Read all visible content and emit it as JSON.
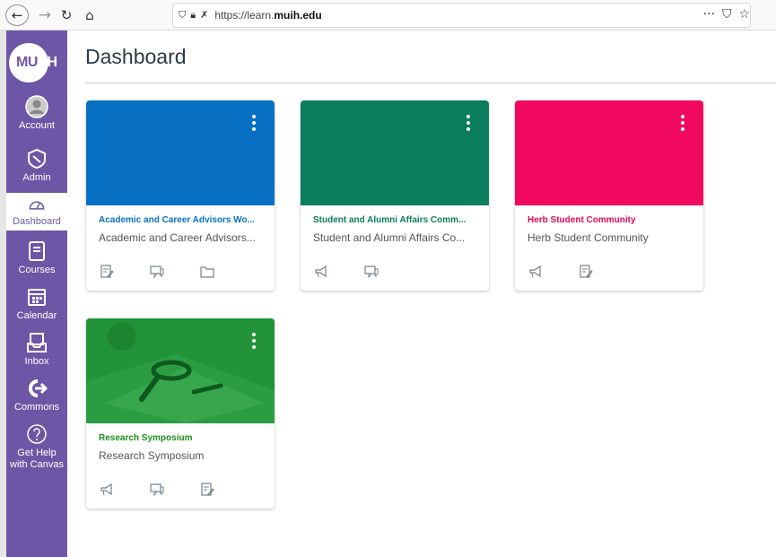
{
  "browser": {
    "url_prefix": "https://learn.",
    "url_domain": "muih.edu",
    "more_label": "···"
  },
  "logo": {
    "part1": "MU",
    "part2": "IH"
  },
  "global_nav": {
    "account": "Account",
    "admin": "Admin",
    "dashboard": "Dashboard",
    "courses": "Courses",
    "calendar": "Calendar",
    "inbox": "Inbox",
    "commons": "Commons",
    "help_line1": "Get Help",
    "help_line2": "with Canvas"
  },
  "page": {
    "title": "Dashboard"
  },
  "colors": {
    "nav_purple": "#6e56a6",
    "card1": "#0770c2",
    "card2": "#0a7d5c",
    "card3": "#f0095e",
    "card4": "#1e8c32"
  },
  "cards": [
    {
      "title": "Academic and Career Advisors Wo...",
      "subtitle": "Academic and Career Advisors...",
      "title_color": "#0770c2",
      "actions": [
        "assignments-icon",
        "discussions-icon",
        "files-icon"
      ]
    },
    {
      "title": "Student and Alumni Affairs Comm...",
      "subtitle": "Student and Alumni Affairs Co...",
      "title_color": "#0a7d5c",
      "actions": [
        "announcements-icon",
        "discussions-icon"
      ]
    },
    {
      "title": "Herb Student Community",
      "subtitle": "Herb Student Community",
      "title_color": "#e0085a",
      "actions": [
        "announcements-icon",
        "assignments-icon"
      ]
    },
    {
      "title": "Research Symposium",
      "subtitle": "Research Symposium",
      "title_color": "#1e8c1e",
      "actions": [
        "announcements-icon",
        "discussions-icon",
        "assignments-icon"
      ]
    }
  ]
}
